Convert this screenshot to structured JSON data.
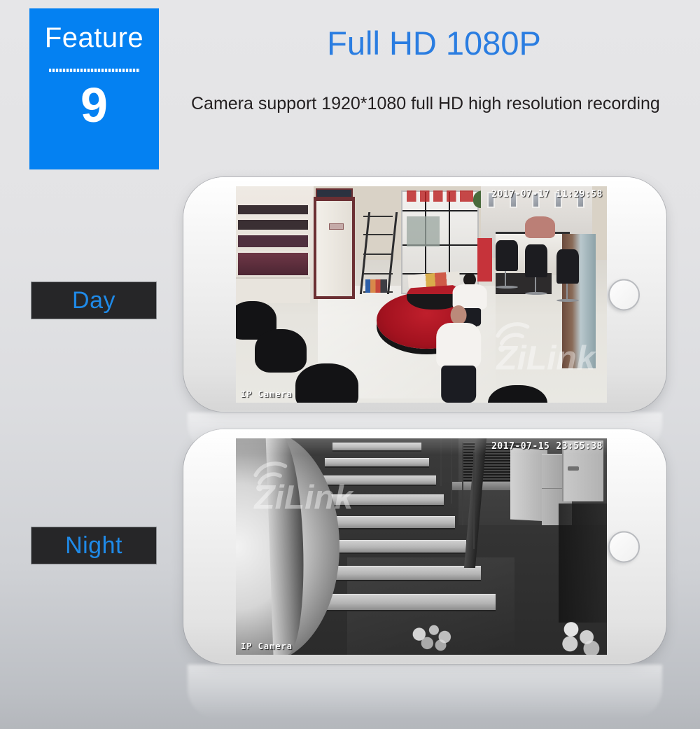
{
  "feature_badge": {
    "label": "Feature",
    "number": "9",
    "bg_color": "#0481f2",
    "text_color": "#ffffff"
  },
  "headline": {
    "title": "Full HD 1080P",
    "title_color": "#2a7de1",
    "description": "Camera support 1920*1080 full HD high resolution recording"
  },
  "modes": {
    "day": {
      "label": "Day",
      "label_color": "#1f8ae8",
      "label_bg": "#262628"
    },
    "night": {
      "label": "Night",
      "label_color": "#1f8ae8",
      "label_bg": "#262628"
    }
  },
  "day_feed": {
    "date": "2017-07-17",
    "time": "11:29:58",
    "channel_label": "IP Camera",
    "scene": "daytime-color-hair-salon-interior",
    "watermark": "ZiLink"
  },
  "night_feed": {
    "date": "2017-07-15",
    "time": "23:55:38",
    "channel_label": "IP Camera",
    "scene": "night-vision-grayscale-staircase-hallway",
    "watermark": "ZiLink"
  },
  "icons": {
    "home_button": "home-button-icon",
    "earpiece": "earpiece-speaker-icon",
    "front_camera": "front-camera-icon",
    "proximity_sensor": "proximity-sensor-icon",
    "wifi_signal": "wifi-signal-icon"
  },
  "background": {
    "gradient_top": "#e6e6e8",
    "gradient_bottom": "#b4b7bc"
  }
}
